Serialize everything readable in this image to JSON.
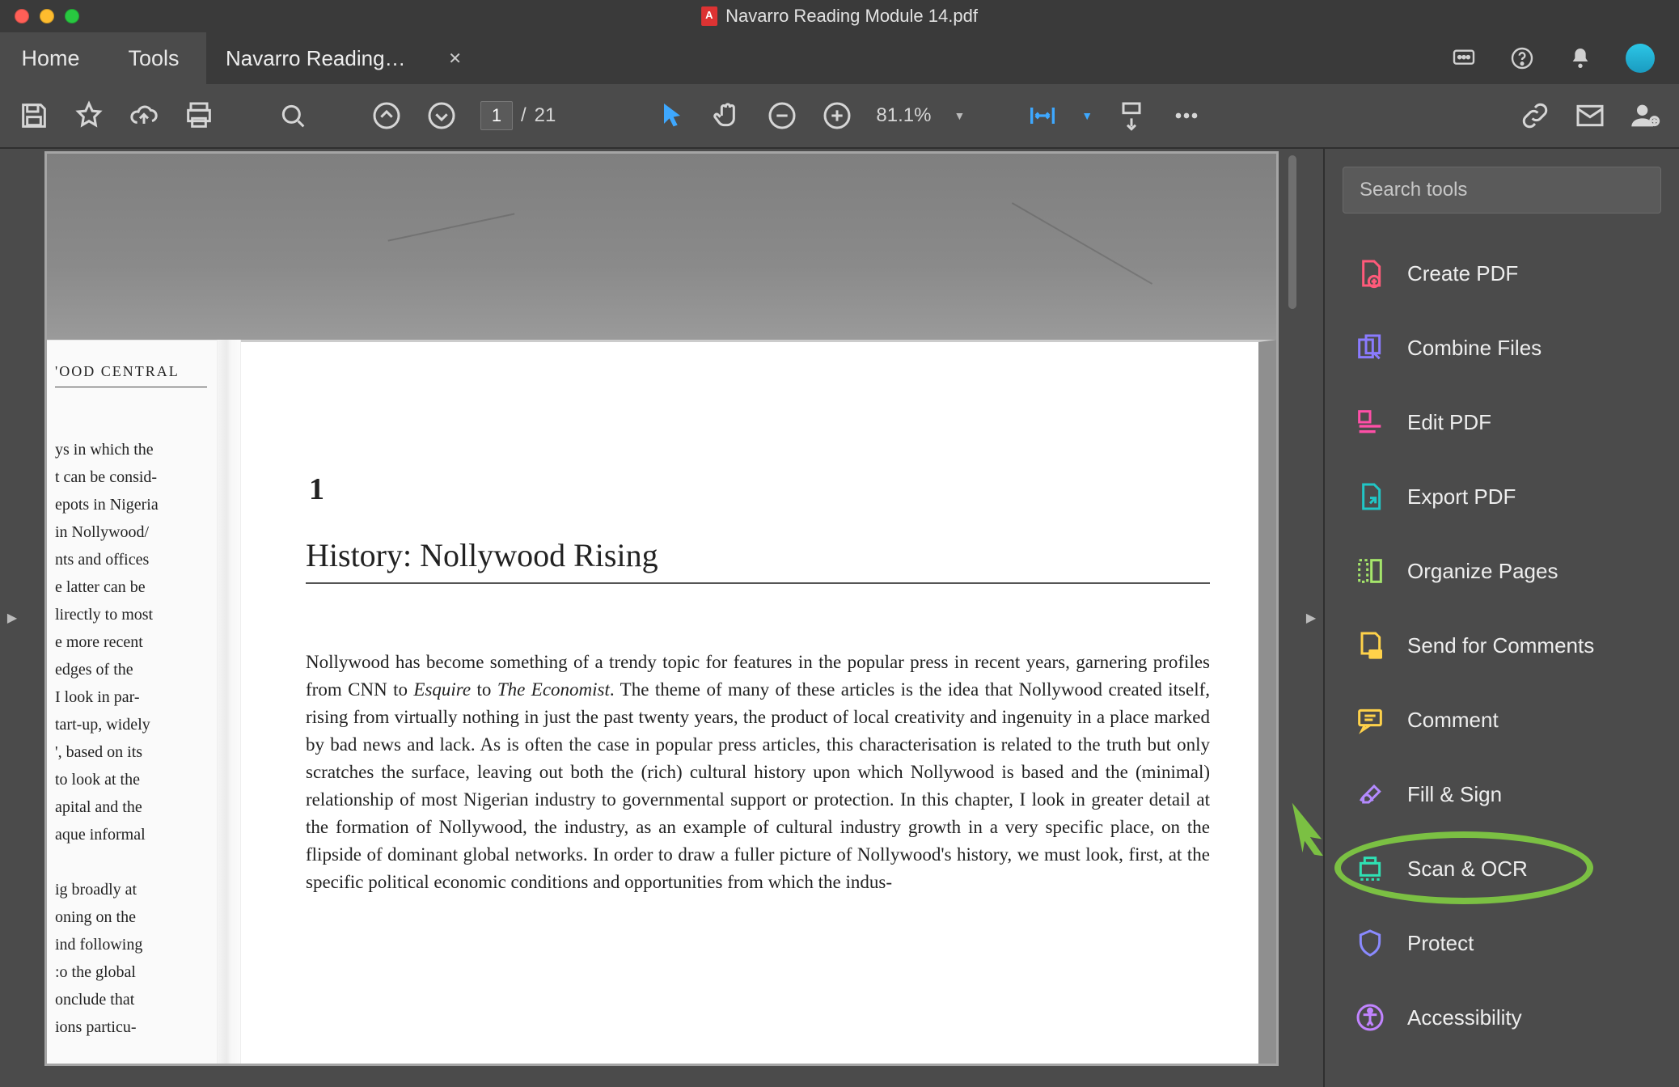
{
  "window": {
    "title": "Navarro Reading Module 14.pdf"
  },
  "tabs": {
    "home": "Home",
    "tools": "Tools",
    "file_short": "Navarro Reading…"
  },
  "toolbar": {
    "page_current": "1",
    "page_prefix": "/",
    "page_total": "21",
    "zoom": "81.1%"
  },
  "document": {
    "left_header": "'OOD CENTRAL",
    "left_lines": [
      "ys in which the",
      "t can be consid-",
      "epots in Nigeria",
      " in Nollywood/",
      "nts and offices",
      "e latter can be",
      "lirectly to most",
      "e more recent",
      " edges of the",
      " I look in par-",
      "tart-up, widely",
      "', based on its",
      "to look at the",
      "apital and the",
      "aque informal",
      "",
      "ig broadly at",
      "oning on the",
      "ind following",
      ":o the global",
      "onclude that",
      "ions particu-"
    ],
    "chapter_number": "1",
    "chapter_title": "History: Nollywood Rising",
    "body_parts": [
      {
        "t": "text",
        "s": "Nollywood has become something of a trendy topic for features in the popular press in recent years, garnering profiles from CNN to "
      },
      {
        "t": "i",
        "s": "Esquire"
      },
      {
        "t": "text",
        "s": " to "
      },
      {
        "t": "i",
        "s": "The Economist"
      },
      {
        "t": "text",
        "s": ". The theme of many of these articles is the idea that Nollywood created itself, rising from virtually nothing in just the past twenty years, the product of local creativity and ingenuity in a place marked by bad news and lack. As is often the case in popular press articles, this characterisation is related to the truth but only scratches the surface, leaving out both the (rich) cultural history upon which Nollywood is based and the (minimal) relationship of most Nigerian industry to governmental support or protection. In this chapter, I look in greater detail at the formation of Nollywood, the industry, as an example of cultural industry growth in a very specific place, on the flipside of dominant global networks. In order to draw a fuller picture of Nollywood's history, we must look, first, at the specific political economic conditions and opportunities from which the indus-"
      }
    ]
  },
  "right_panel": {
    "search_placeholder": "Search tools",
    "tools": [
      {
        "id": "create-pdf",
        "label": "Create PDF",
        "color": "#ff5a7a"
      },
      {
        "id": "combine-files",
        "label": "Combine Files",
        "color": "#8a7bff"
      },
      {
        "id": "edit-pdf",
        "label": "Edit PDF",
        "color": "#ff4fa7"
      },
      {
        "id": "export-pdf",
        "label": "Export PDF",
        "color": "#21c6c6"
      },
      {
        "id": "organize-pages",
        "label": "Organize Pages",
        "color": "#a5e66b"
      },
      {
        "id": "send-for-comments",
        "label": "Send for Comments",
        "color": "#ffd24a"
      },
      {
        "id": "comment",
        "label": "Comment",
        "color": "#ffd24a"
      },
      {
        "id": "fill-sign",
        "label": "Fill & Sign",
        "color": "#b48aff"
      },
      {
        "id": "scan-ocr",
        "label": "Scan & OCR",
        "color": "#2fe0b3",
        "highlight": true
      },
      {
        "id": "protect",
        "label": "Protect",
        "color": "#8a8aff"
      },
      {
        "id": "accessibility",
        "label": "Accessibility",
        "color": "#c184ff"
      }
    ]
  }
}
